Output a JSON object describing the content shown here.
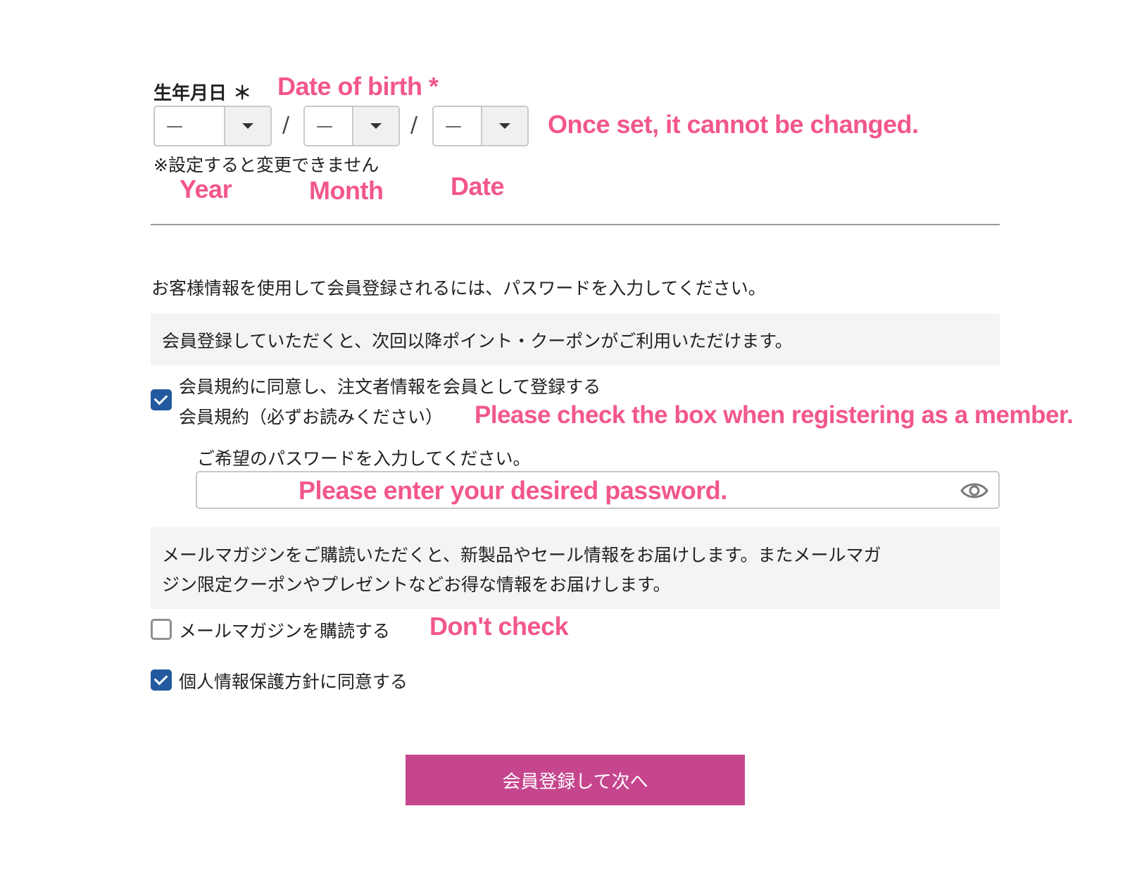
{
  "dob": {
    "label": "生年月日",
    "required_mark": "＊",
    "year_value": "—",
    "month_value": "—",
    "date_value": "—",
    "separator": "/",
    "note": "※設定すると変更できません"
  },
  "intro_text": "お客様情報を使用して会員登録されるには、パスワードを入力してください。",
  "member_info_box": "会員登録していただくと、次回以降ポイント・クーポンがご利用いただけます。",
  "terms": {
    "checked": true,
    "line1": "会員規約に同意し、注文者情報を会員として登録する",
    "line2": "会員規約（必ずお読みください）"
  },
  "password": {
    "label": "ご希望のパスワードを入力してください。",
    "value": "",
    "visibility_icon": "eye-icon"
  },
  "newsletter_box": {
    "line1": "メールマガジンをご購読いただくと、新製品やセール情報をお届けします。またメールマガ",
    "line2": "ジン限定クーポンやプレゼントなどお得な情報をお届けします。"
  },
  "newsletter": {
    "checked": false,
    "label": "メールマガジンを購読する"
  },
  "privacy": {
    "checked": true,
    "label": "個人情報保護方針に同意する"
  },
  "submit_label": "会員登録して次へ",
  "annotations": {
    "dob": "Date of birth *",
    "cannot_change": "Once set, it cannot be changed.",
    "year": "Year",
    "month": "Month",
    "date": "Date",
    "check_box": "Please check the box when registering as a member.",
    "enter_password": "Please enter your desired password.",
    "dont_check": "Don't check"
  },
  "colors": {
    "annotation": "#f2578a",
    "checkbox": "#23599e",
    "button": "#c6468e"
  }
}
